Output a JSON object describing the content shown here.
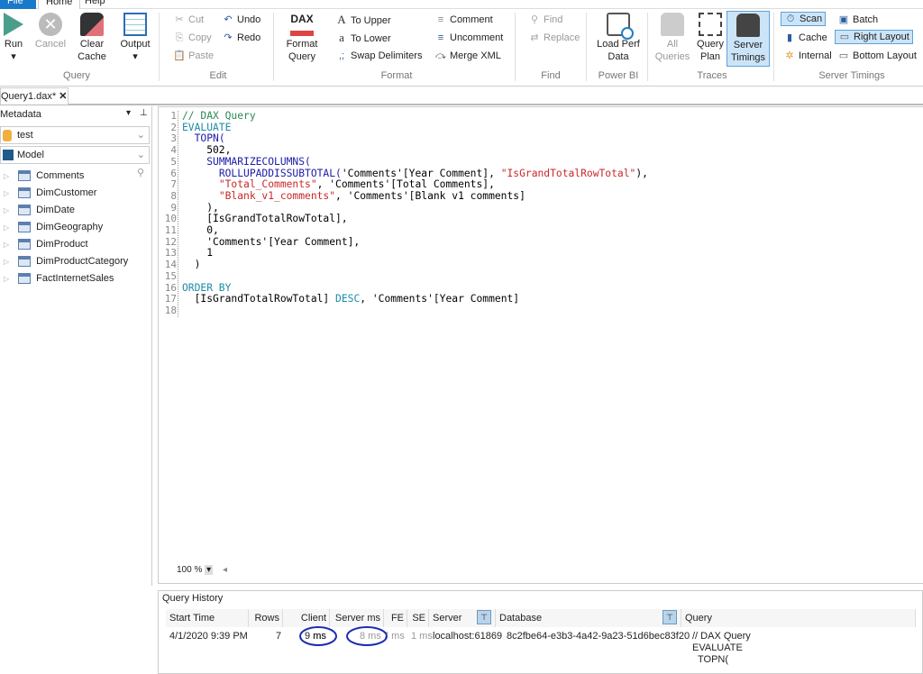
{
  "menu_tabs": [
    "File",
    "Home",
    "Help"
  ],
  "ribbon": {
    "query": {
      "run": "Run",
      "cancel": "Cancel",
      "clear_cache": "Clear Cache",
      "output": "Output",
      "group": "Query"
    },
    "edit": {
      "cut": "Cut",
      "copy": "Copy",
      "paste": "Paste",
      "undo": "Undo",
      "redo": "Redo",
      "group": "Edit"
    },
    "format": {
      "format_query": "Format Query",
      "dax_logo": "DAX",
      "to_upper": "To Upper",
      "to_lower": "To Lower",
      "swap": "Swap Delimiters",
      "comment": "Comment",
      "uncomment": "Uncomment",
      "merge_xml": "Merge XML",
      "group": "Format"
    },
    "find": {
      "find": "Find",
      "replace": "Replace",
      "group": "Find"
    },
    "powerbi": {
      "load_perf": "Load Perf Data",
      "group": "Power BI"
    },
    "traces": {
      "all_queries": "All Queries",
      "query_plan": "Query Plan",
      "server_timings": "Server Timings",
      "group": "Traces"
    },
    "server_timings": {
      "scan": "Scan",
      "cache": "Cache",
      "internal": "Internal",
      "batch": "Batch",
      "right_layout": "Right Layout",
      "bottom_layout": "Bottom Layout",
      "group": "Server Timings"
    }
  },
  "document_tab": "Query1.dax*",
  "metadata": {
    "title": "Metadata",
    "database": "test",
    "model": "Model",
    "tables": [
      "Comments",
      "DimCustomer",
      "DimDate",
      "DimGeography",
      "DimProduct",
      "DimProductCategory",
      "FactInternetSales"
    ]
  },
  "editor": {
    "zoom": "100 %",
    "lines": [
      [
        [
          "// DAX Query",
          "cm"
        ]
      ],
      [
        [
          "EVALUATE",
          "kw"
        ]
      ],
      [
        [
          "  "
        ],
        [
          "TOPN(",
          "fn"
        ]
      ],
      [
        [
          "    502,"
        ]
      ],
      [
        [
          "    "
        ],
        [
          "SUMMARIZECOLUMNS(",
          "fn"
        ]
      ],
      [
        [
          "      "
        ],
        [
          "ROLLUPADDISSUBTOTAL(",
          "fn"
        ],
        [
          "'Comments'[Year Comment], "
        ],
        [
          "\"IsGrandTotalRowTotal\"",
          "str"
        ],
        [
          "),"
        ]
      ],
      [
        [
          "      "
        ],
        [
          "\"Total_Comments\"",
          "str"
        ],
        [
          ", 'Comments'[Total Comments],"
        ]
      ],
      [
        [
          "      "
        ],
        [
          "\"Blank_v1_comments\"",
          "str"
        ],
        [
          ", 'Comments'[Blank v1 comments]"
        ]
      ],
      [
        [
          "    ),"
        ]
      ],
      [
        [
          "    [IsGrandTotalRowTotal],"
        ]
      ],
      [
        [
          "    0,"
        ]
      ],
      [
        [
          "    'Comments'[Year Comment],"
        ]
      ],
      [
        [
          "    1"
        ]
      ],
      [
        [
          "  )"
        ]
      ],
      [
        [
          ""
        ]
      ],
      [
        [
          "ORDER BY",
          "kw"
        ]
      ],
      [
        [
          "  [IsGrandTotalRowTotal] "
        ],
        [
          "DESC",
          "kw"
        ],
        [
          ", 'Comments'[Year Comment]"
        ]
      ],
      [
        [
          ""
        ]
      ]
    ]
  },
  "history": {
    "title": "Query History",
    "columns": [
      "Start Time",
      "Rows",
      "Client ms",
      "Server ms",
      "FE",
      "SE",
      "Server",
      "Database",
      "Query"
    ],
    "row": {
      "start": "4/1/2020 9:39 PM",
      "rows": "7",
      "client": "9 ms",
      "server": "8 ms",
      "fe": "7 ms",
      "se": "1 ms",
      "server_name": "localhost:61869",
      "database": "8c2fbe64-e3b3-4a42-9a23-51d6bec83f20",
      "query": [
        "// DAX Query",
        "EVALUATE",
        "TOPN("
      ]
    }
  },
  "colors": {
    "accent": "#1979ca",
    "selected": "#cce4f7",
    "annotation": "#1a2db0"
  }
}
